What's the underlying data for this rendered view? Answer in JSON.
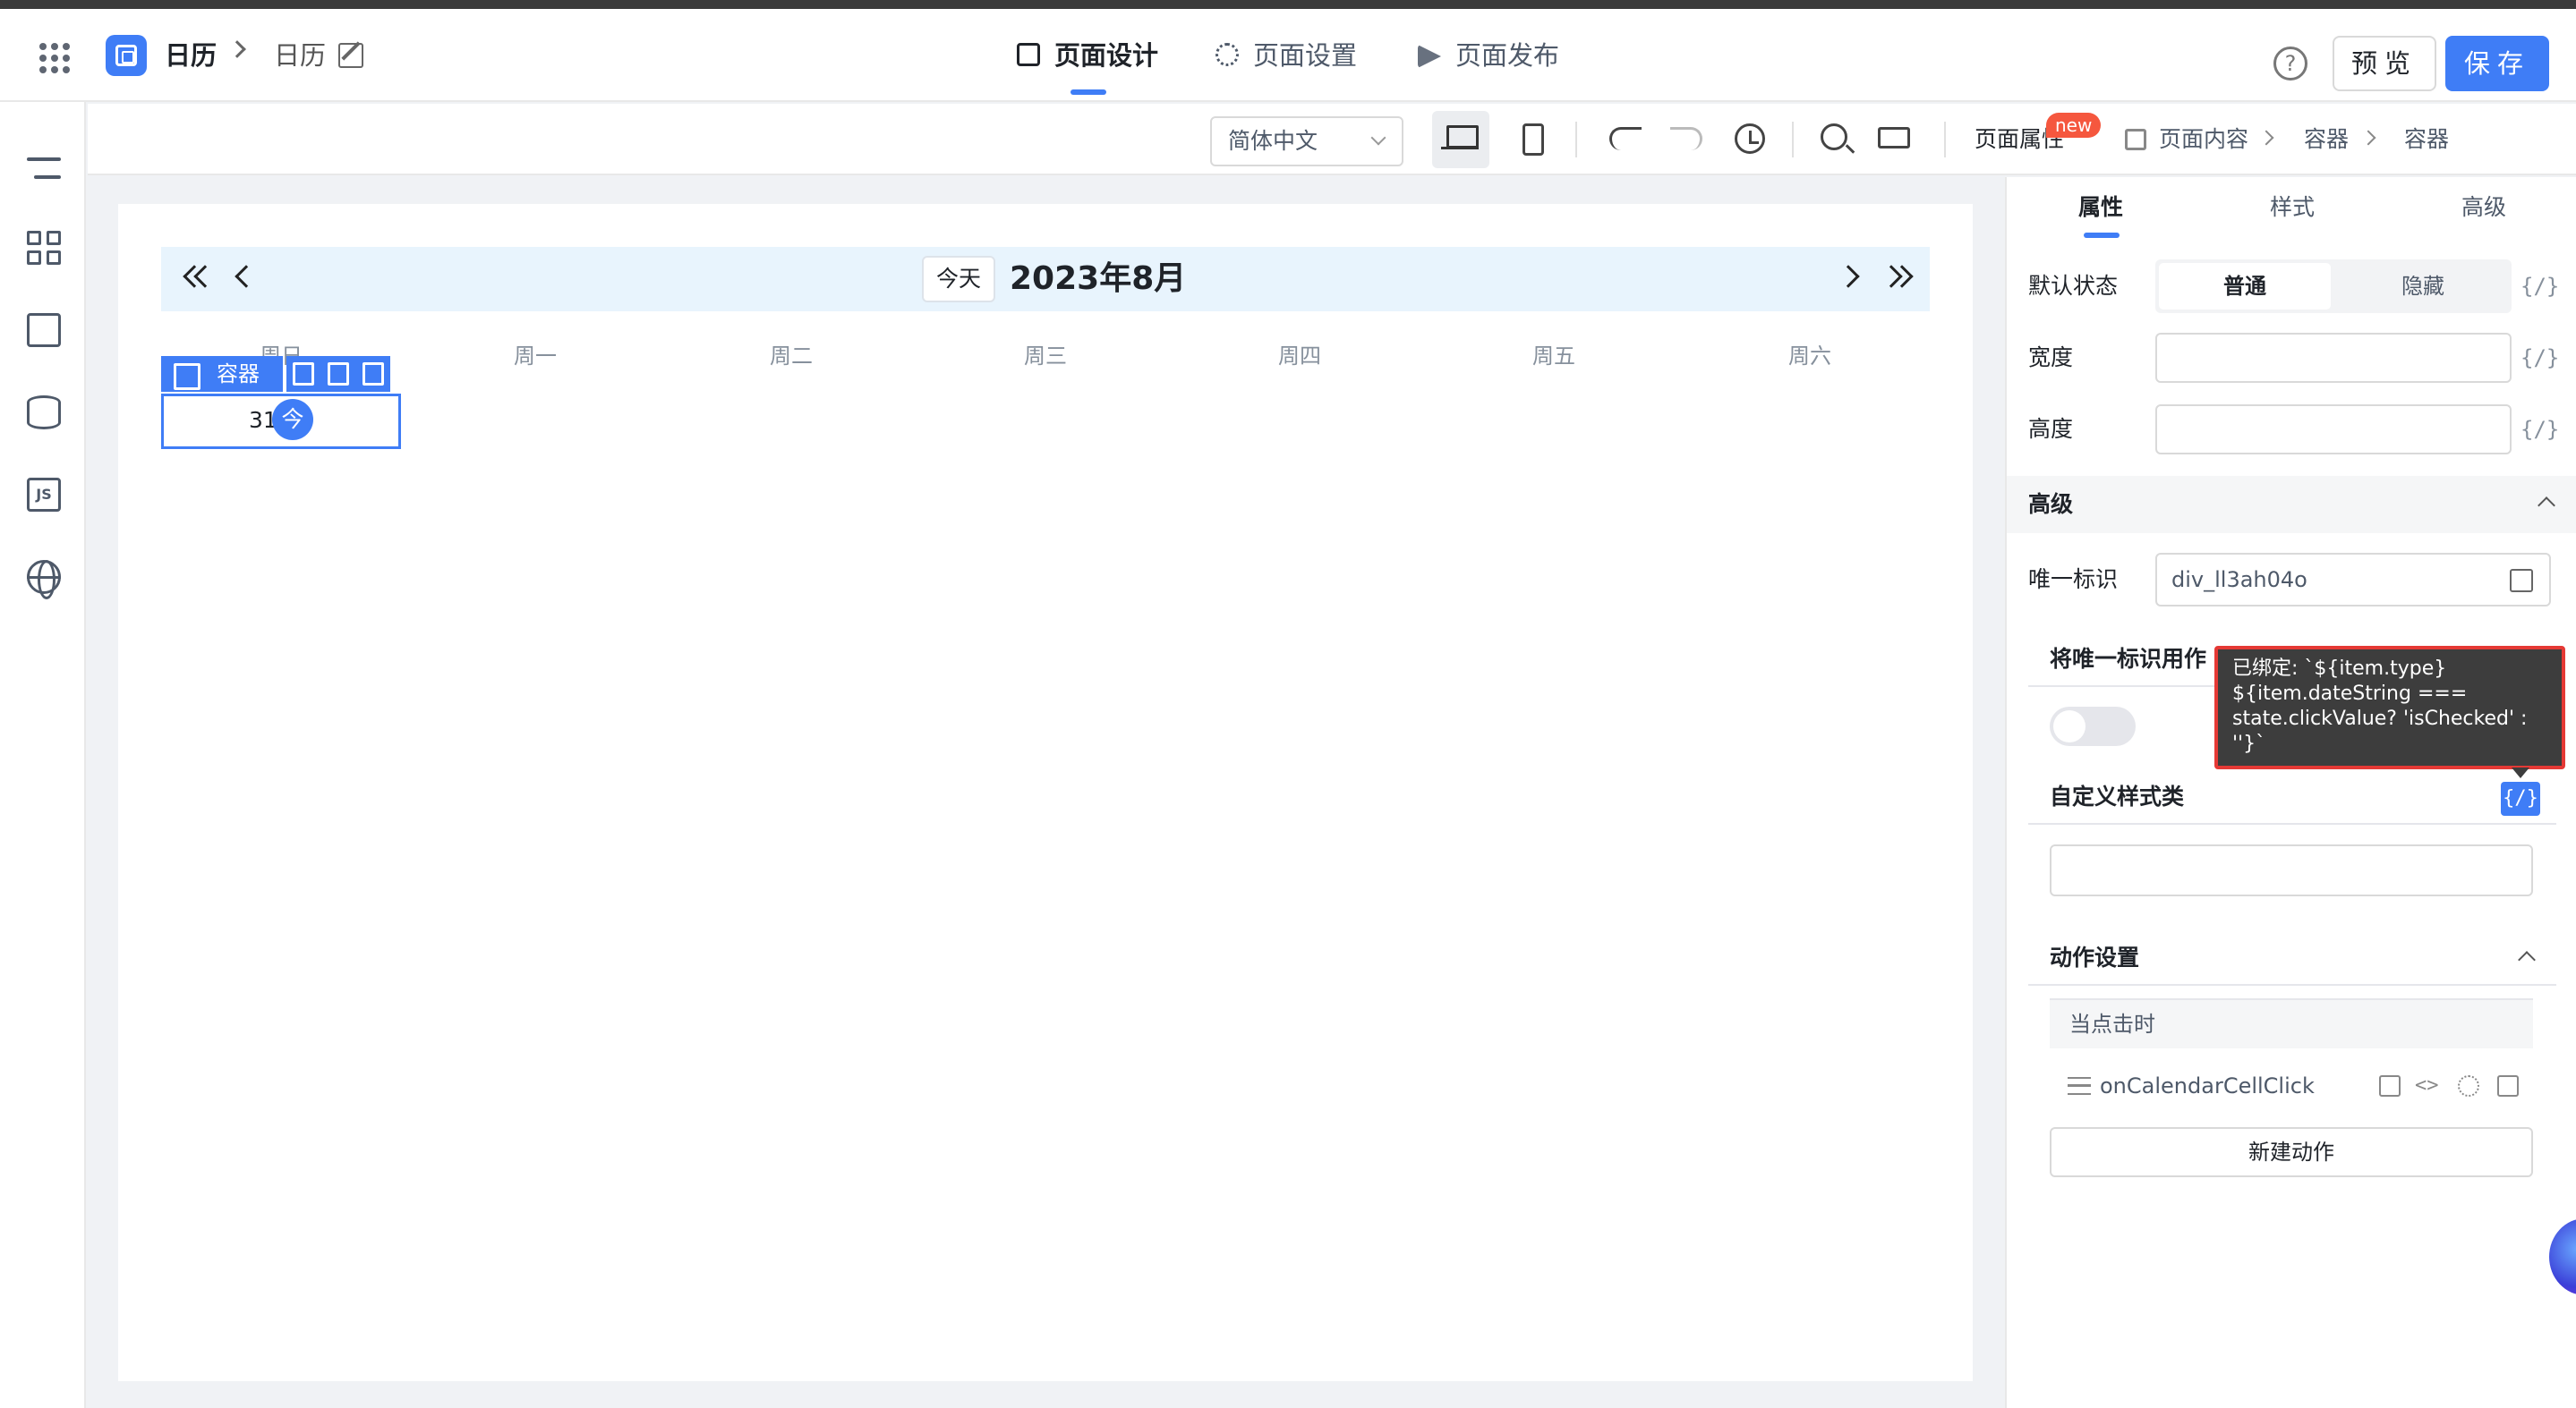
{
  "header": {
    "app_name": "日历",
    "page_name": "日历",
    "tabs": [
      {
        "label": "页面设计",
        "active": true
      },
      {
        "label": "页面设置",
        "active": false
      },
      {
        "label": "页面发布",
        "active": false
      }
    ],
    "help": "?",
    "preview_label": "预览",
    "save_label": "保存",
    "accent": "#3f7df6"
  },
  "toolbar": {
    "language": "简体中文",
    "page_attr_label": "页面属性",
    "new_badge": "new",
    "breadcrumb": [
      "页面内容",
      "容器",
      "容器"
    ]
  },
  "calendar": {
    "today_label": "今天",
    "month": "2023年8月",
    "weekdays": [
      "周日",
      "周一",
      "周二",
      "周三",
      "周四",
      "周五",
      "周六"
    ],
    "selected_day": "31",
    "today_marker": "今",
    "selection_label": "容器"
  },
  "panel": {
    "tabs": [
      "属性",
      "样式",
      "高级"
    ],
    "default_state_label": "默认状态",
    "state_options": [
      "普通",
      "隐藏"
    ],
    "width_label": "宽度",
    "height_label": "高度",
    "fx": "{/}",
    "advanced_section": "高级",
    "uid_label": "唯一标识",
    "uid_value": "div_ll3ah04o",
    "uid_as_label": "将唯一标识用作",
    "custom_class_label": "自定义样式类",
    "tooltip": "已绑定: `${item.type}\n${item.dateString ===\nstate.clickValue? 'isChecked' :\n''}`",
    "actions_section": "动作设置",
    "when_click": "当点击时",
    "action_name": "onCalendarCellClick",
    "new_action": "新建动作"
  }
}
